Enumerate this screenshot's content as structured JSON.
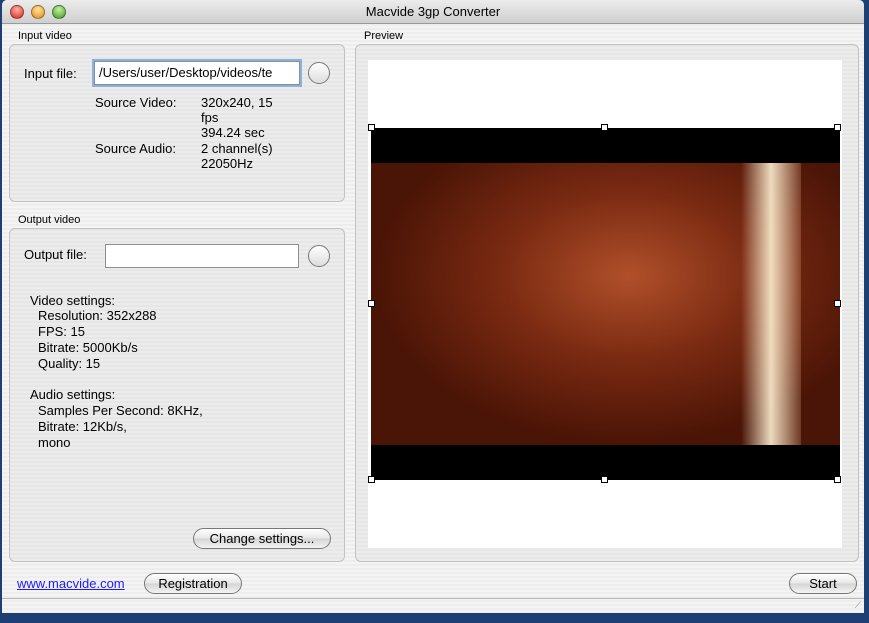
{
  "window": {
    "title": "Macvide 3gp Converter"
  },
  "input": {
    "group_label": "Input video",
    "file_label": "Input file:",
    "file_value": "/Users/user/Desktop/videos/te",
    "source_video_label": "Source Video:",
    "source_video_lines": [
      "320x240, 15",
      "fps",
      "394.24 sec"
    ],
    "source_audio_label": "Source Audio:",
    "source_audio_lines": [
      "2 channel(s)",
      "22050Hz"
    ]
  },
  "output": {
    "group_label": "Output video",
    "file_label": "Output file:",
    "file_value": "",
    "video_settings": [
      "Video settings:",
      "Resolution: 352x288",
      "FPS: 15",
      "Bitrate: 5000Kb/s",
      "Quality: 15"
    ],
    "audio_settings": [
      "Audio settings:",
      "Samples Per Second: 8KHz,",
      "Bitrate: 12Kb/s,",
      "mono"
    ],
    "change_settings": "Change settings..."
  },
  "preview": {
    "group_label": "Preview"
  },
  "footer": {
    "link": "www.macvide.com",
    "registration": "Registration",
    "start": "Start"
  },
  "colors": {
    "link": "#1a1aff",
    "desktop": "#1d3f74"
  }
}
